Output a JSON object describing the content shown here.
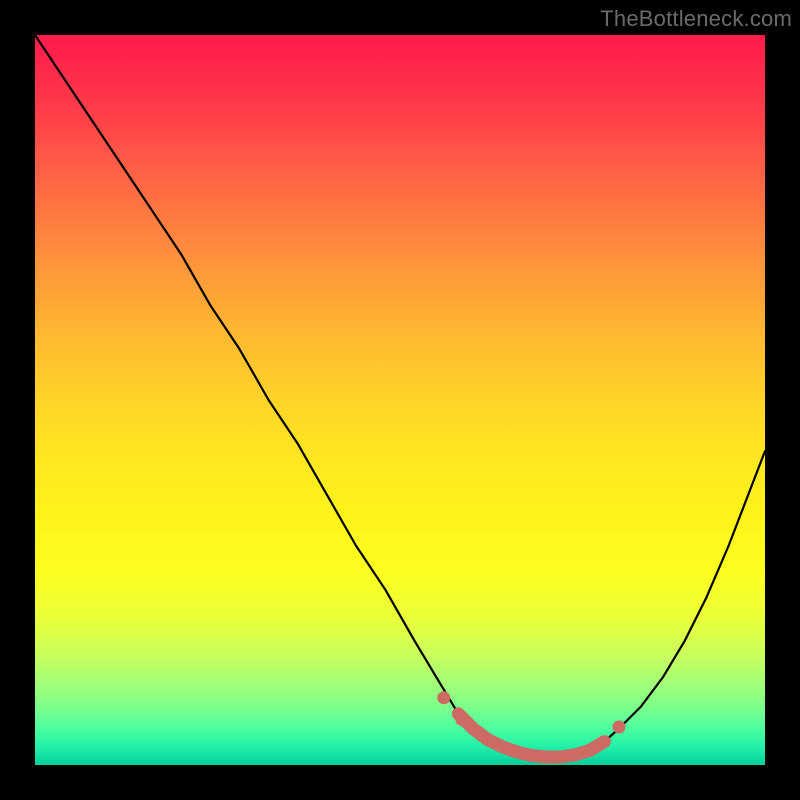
{
  "watermark": "TheBottleneck.com",
  "accent": {
    "curve": "#000000",
    "highlight": "#cc6a63"
  },
  "chart_data": {
    "type": "line",
    "title": "",
    "xlabel": "",
    "ylabel": "",
    "xlim": [
      0,
      100
    ],
    "ylim": [
      0,
      100
    ],
    "grid": false,
    "legend": false,
    "annotations": [],
    "series": [
      {
        "name": "curve",
        "x": [
          0,
          4,
          8,
          12,
          16,
          20,
          24,
          28,
          32,
          36,
          40,
          44,
          48,
          52,
          55,
          58,
          60,
          62,
          64,
          66,
          68,
          70,
          72,
          74,
          76,
          78,
          80,
          83,
          86,
          89,
          92,
          95,
          100
        ],
        "values": [
          100,
          94,
          88,
          82,
          76,
          70,
          63,
          57,
          50,
          44,
          37,
          30,
          24,
          17,
          12,
          7,
          5,
          3.5,
          2.5,
          1.8,
          1.3,
          1.1,
          1.1,
          1.4,
          2,
          3.2,
          5,
          8,
          12,
          17,
          23,
          30,
          43
        ]
      },
      {
        "name": "highlight_segment",
        "x": [
          58,
          60,
          62,
          64,
          66,
          68,
          70,
          72,
          74,
          76,
          78
        ],
        "values": [
          7,
          5,
          3.5,
          2.5,
          1.8,
          1.3,
          1.1,
          1.1,
          1.4,
          2,
          3.2
        ]
      },
      {
        "name": "highlight_dots",
        "x": [
          56,
          58.5,
          80
        ],
        "values": [
          9.2,
          6.2,
          5.2
        ]
      }
    ]
  }
}
